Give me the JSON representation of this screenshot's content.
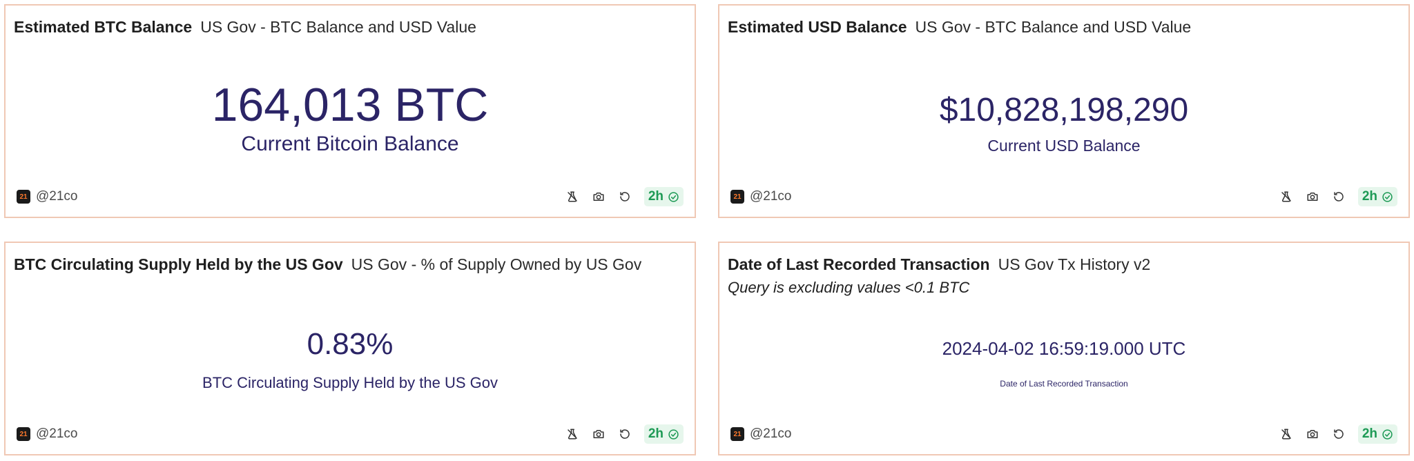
{
  "cards": [
    {
      "title": "Estimated BTC Balance",
      "source": "US Gov - BTC Balance and USD Value",
      "value": "164,013 BTC",
      "label": "Current Bitcoin Balance",
      "author": "@21co",
      "freshness": "2h"
    },
    {
      "title": "Estimated USD Balance",
      "source": "US Gov - BTC Balance and USD Value",
      "value": "$10,828,198,290",
      "label": "Current USD Balance",
      "author": "@21co",
      "freshness": "2h"
    },
    {
      "title": "BTC Circulating Supply Held by the US Gov",
      "source": "US Gov - % of Supply Owned by US Gov",
      "value": "0.83%",
      "label": "BTC Circulating Supply Held by the US Gov",
      "author": "@21co",
      "freshness": "2h"
    },
    {
      "title": "Date of Last Recorded Transaction",
      "source": "US Gov Tx History v2",
      "subtitle": "Query is excluding values <0.1 BTC",
      "value": "2024-04-02 16:59:19.000 UTC",
      "label": "Date of Last Recorded Transaction",
      "author": "@21co",
      "freshness": "2h"
    }
  ],
  "avatar_text": "21",
  "colors": {
    "border": "#f0c8b4",
    "counter_text": "#2b2466",
    "badge_bg": "#e6f6ec",
    "badge_text": "#1d9a55",
    "avatar_bg": "#1a1a1a",
    "avatar_text": "#ff7a2d"
  },
  "icons": [
    "flask-icon",
    "camera-icon",
    "refresh-icon",
    "check-circle-icon"
  ]
}
